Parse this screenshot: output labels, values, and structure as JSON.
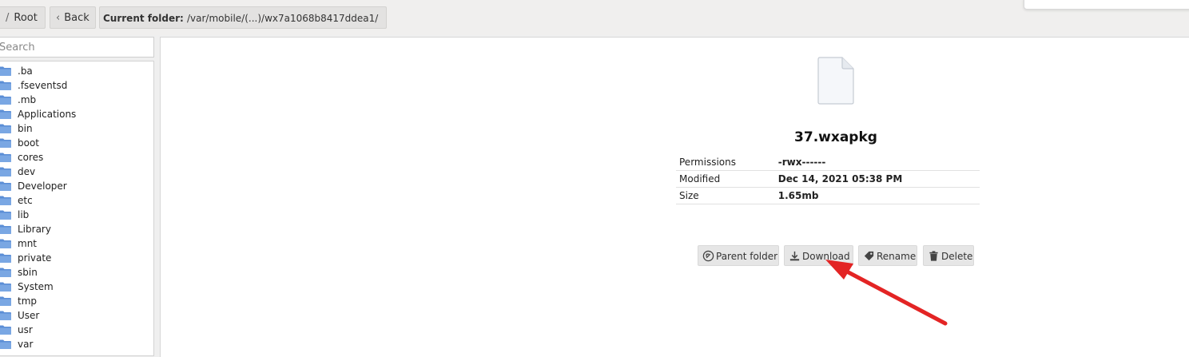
{
  "breadcrumb": {
    "separator": "/",
    "root_label": "Root",
    "back_label": "Back",
    "current_folder_label": "Current folder:",
    "current_folder_path": "/var/mobile/(...)/wx7a1068b8417ddea1/"
  },
  "sidebar": {
    "search_placeholder": "Search",
    "items": [
      {
        "label": ".ba"
      },
      {
        "label": ".fseventsd"
      },
      {
        "label": ".mb"
      },
      {
        "label": "Applications"
      },
      {
        "label": "bin"
      },
      {
        "label": "boot"
      },
      {
        "label": "cores"
      },
      {
        "label": "dev"
      },
      {
        "label": "Developer"
      },
      {
        "label": "etc"
      },
      {
        "label": "lib"
      },
      {
        "label": "Library"
      },
      {
        "label": "mnt"
      },
      {
        "label": "private"
      },
      {
        "label": "sbin"
      },
      {
        "label": "System"
      },
      {
        "label": "tmp"
      },
      {
        "label": "User"
      },
      {
        "label": "usr"
      },
      {
        "label": "var"
      }
    ]
  },
  "file": {
    "name": "37.wxapkg",
    "icon": "document-icon",
    "details": [
      {
        "key": "Permissions",
        "value": "-rwx------"
      },
      {
        "key": "Modified",
        "value": "Dec 14, 2021 05:38 PM"
      },
      {
        "key": "Size",
        "value": "1.65mb"
      }
    ]
  },
  "actions": {
    "parent_folder": "Parent folder",
    "download": "Download",
    "rename": "Rename",
    "delete": "Delete"
  },
  "colors": {
    "annotation_arrow": "#e32424",
    "folder_icon": "#5b8ed6"
  }
}
